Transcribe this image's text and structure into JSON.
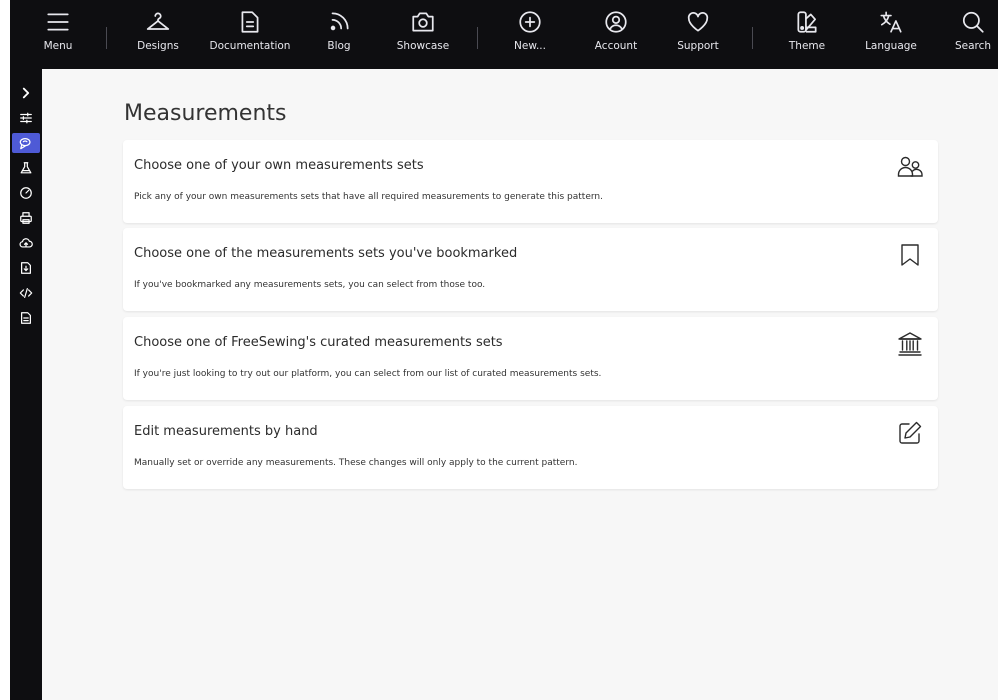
{
  "topnav": {
    "items": [
      {
        "label": "Menu",
        "icon": "menu-icon"
      },
      {
        "label": "Designs",
        "icon": "hanger-icon"
      },
      {
        "label": "Documentation",
        "icon": "document-icon"
      },
      {
        "label": "Blog",
        "icon": "rss-icon"
      },
      {
        "label": "Showcase",
        "icon": "camera-icon"
      },
      {
        "label": "New...",
        "icon": "plus-circle-icon"
      },
      {
        "label": "Account",
        "icon": "user-circle-icon"
      },
      {
        "label": "Support",
        "icon": "heart-icon"
      },
      {
        "label": "Theme",
        "icon": "swatch-icon"
      },
      {
        "label": "Language",
        "icon": "translate-icon"
      },
      {
        "label": "Search",
        "icon": "search-icon"
      }
    ]
  },
  "sidebar": {
    "items": [
      {
        "icon": "chevron-right-icon"
      },
      {
        "icon": "sliders-icon"
      },
      {
        "icon": "measuring-tape-icon",
        "active": true
      },
      {
        "icon": "flask-icon"
      },
      {
        "icon": "gauge-icon"
      },
      {
        "icon": "printer-icon"
      },
      {
        "icon": "cloud-upload-icon"
      },
      {
        "icon": "export-icon"
      },
      {
        "icon": "code-icon"
      },
      {
        "icon": "document-icon"
      }
    ]
  },
  "page": {
    "title": "Measurements"
  },
  "cards": [
    {
      "title": "Choose one of your own measurements sets",
      "description": "Pick any of your own measurements sets that have all required measurements to generate this pattern.",
      "icon": "users-icon"
    },
    {
      "title": "Choose one of the measurements sets you've bookmarked",
      "description": "If you've bookmarked any measurements sets, you can select from those too.",
      "icon": "bookmark-icon"
    },
    {
      "title": "Choose one of FreeSewing's curated measurements sets",
      "description": "If you're just looking to try out our platform, you can select from our list of curated measurements sets.",
      "icon": "institution-icon"
    },
    {
      "title": "Edit measurements by hand",
      "description": "Manually set or override any measurements. These changes will only apply to the current pattern.",
      "icon": "edit-icon"
    }
  ],
  "colors": {
    "nav_bg": "#0e0e11",
    "nav_fg": "#e8e8ee",
    "accent": "#4e5ad6",
    "content_bg": "#f7f7f7",
    "card_bg": "#ffffff"
  }
}
